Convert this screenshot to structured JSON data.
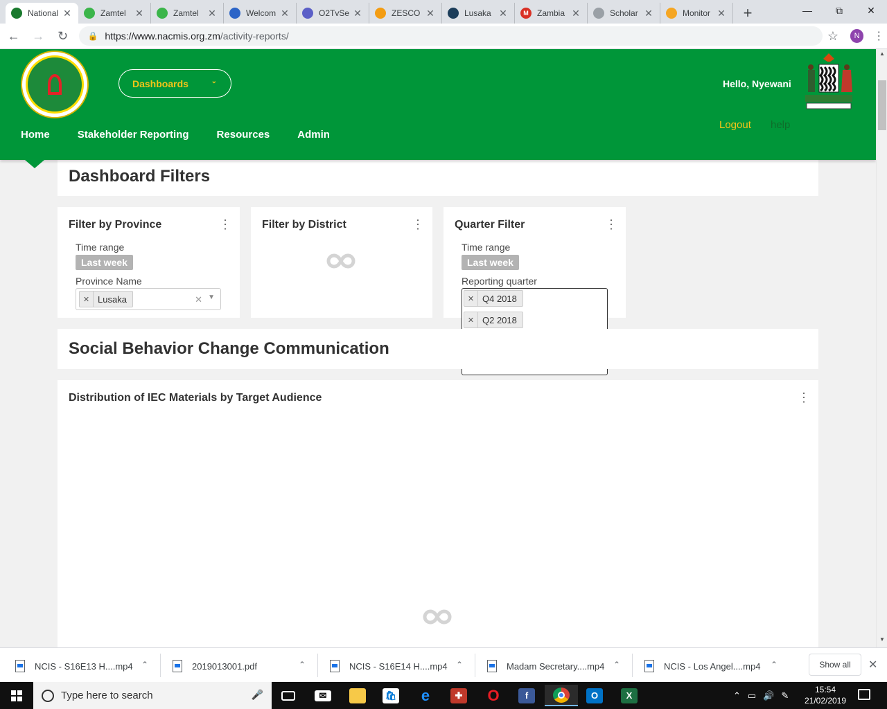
{
  "browser": {
    "tabs": [
      {
        "title": "National",
        "color": "#1a7a2e",
        "glyph": "",
        "active": true
      },
      {
        "title": "Zamtel",
        "color": "#3bb54a",
        "glyph": "",
        "active": false
      },
      {
        "title": "Zamtel",
        "color": "#3bb54a",
        "glyph": "",
        "active": false
      },
      {
        "title": "Welcom",
        "color": "#2b64c7",
        "glyph": "",
        "active": false
      },
      {
        "title": "O2TvSe",
        "color": "#5b5fc7",
        "glyph": "",
        "active": false
      },
      {
        "title": "ZESCO",
        "color": "#f39c12",
        "glyph": "",
        "active": false
      },
      {
        "title": "Lusaka",
        "color": "#1c3d5a",
        "glyph": "",
        "active": false
      },
      {
        "title": "Zambia",
        "color": "#d93025",
        "glyph": "M",
        "active": false
      },
      {
        "title": "Scholar",
        "color": "#9aa0a6",
        "glyph": "",
        "active": false
      },
      {
        "title": "Monitor",
        "color": "#f5a623",
        "glyph": "",
        "active": false
      }
    ],
    "url_host": "https://www.nacmis.org.zm",
    "url_path": "/activity-reports/",
    "profile_initial": "N"
  },
  "site": {
    "dashboards_label": "Dashboards",
    "nav": [
      "Home",
      "Stakeholder Reporting",
      "Resources",
      "Admin"
    ],
    "greeting": "Hello, Nyewani",
    "logout_label": "Logout",
    "help_label": "help",
    "brand_green": "#009639",
    "accent_yellow": "#f5c518"
  },
  "filters": {
    "section_title": "Dashboard Filters",
    "province": {
      "title": "Filter by Province",
      "time_range_label": "Time range",
      "time_range_value": "Last week",
      "field_label": "Province Name",
      "selected": "Lusaka"
    },
    "district": {
      "title": "Filter by District"
    },
    "quarter": {
      "title": "Quarter Filter",
      "time_range_label": "Time range",
      "time_range_value": "Last week",
      "field_label": "Reporting quarter",
      "selected": [
        "Q4 2018",
        "Q2 2018"
      ]
    }
  },
  "sbcc": {
    "section_title": "Social Behavior Change Communication",
    "chart_title": "Distribution of IEC Materials by Target Audience"
  },
  "downloads": {
    "items": [
      "NCIS - S16E13 H....mp4",
      "2019013001.pdf",
      "NCIS - S16E14 H....mp4",
      "Madam Secretary....mp4",
      "NCIS - Los Angel....mp4"
    ],
    "show_all": "Show all"
  },
  "taskbar": {
    "search_placeholder": "Type here to search",
    "time": "15:54",
    "date": "21/02/2019"
  }
}
